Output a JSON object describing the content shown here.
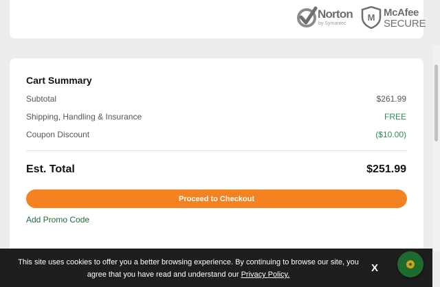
{
  "trust_badges": {
    "norton": {
      "name": "Norton",
      "sub": "by Symantec"
    },
    "mcafee": {
      "name": "McAfee",
      "secure": "SECURE",
      "shield_letter": "M"
    }
  },
  "cart_summary": {
    "title": "Cart Summary",
    "rows": [
      {
        "label": "Subtotal",
        "value": "$261.99"
      },
      {
        "label": "Shipping, Handling & Insurance",
        "value": "FREE"
      },
      {
        "label": "Coupon Discount",
        "value": "($10.00)"
      }
    ],
    "total_label": "Est. Total",
    "total_value": "$251.99",
    "checkout_label": "Proceed to Checkout",
    "promo_label": "Add Promo Code"
  },
  "cookie_banner": {
    "text_before": "This site uses cookies to offer you a better browsing experience. By continuing to browse our site, you agree that you have read and understand our",
    "privacy_link": "Privacy Policy.",
    "close_label": "X"
  },
  "colors": {
    "accent_orange": "#f58220",
    "green_text": "#2e8b57",
    "cookie_bg": "#1e1e1e"
  },
  "icons": {
    "chat": "chat-icon"
  }
}
